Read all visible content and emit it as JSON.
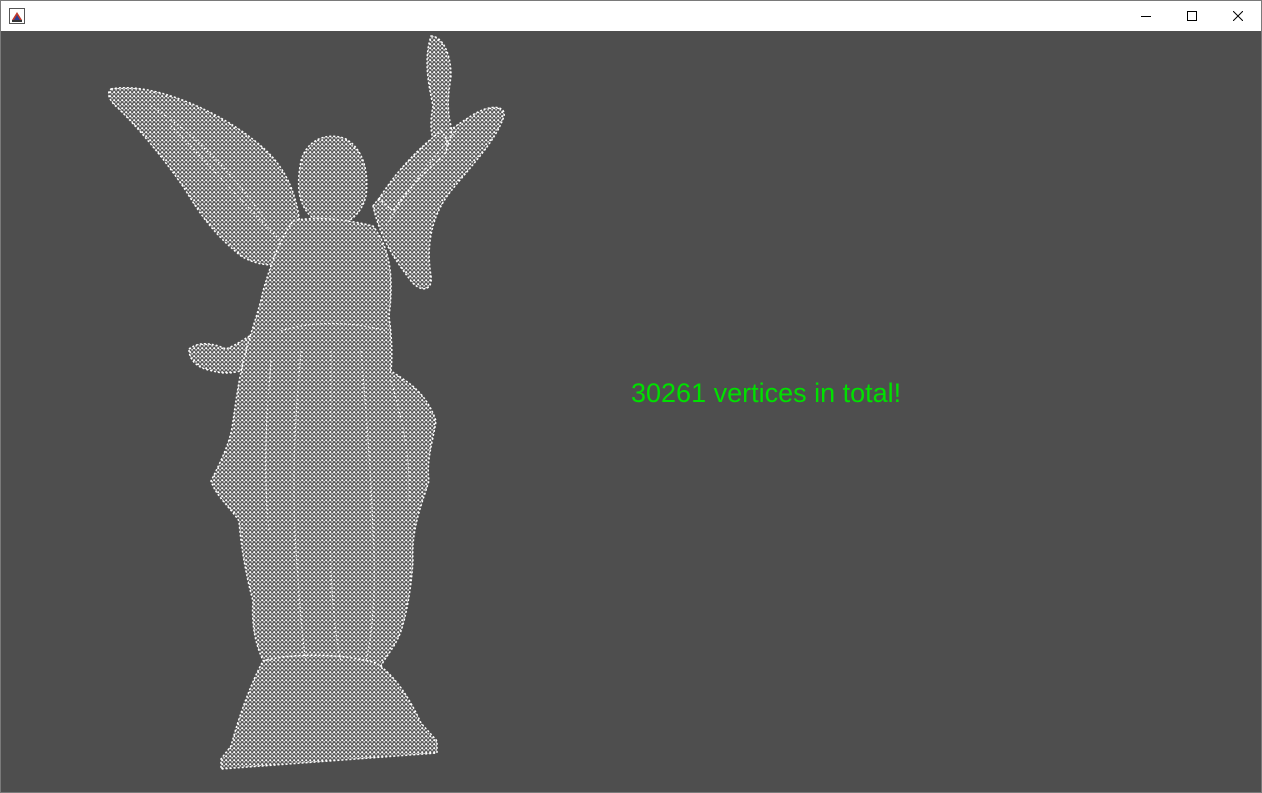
{
  "window": {
    "title": "",
    "app_icon": "java-app-icon",
    "buttons": {
      "minimize_icon": "minimize-icon",
      "maximize_icon": "maximize-icon",
      "close_icon": "close-icon"
    }
  },
  "scene": {
    "background_color": "#4e4e4e",
    "point_color": "#ffffff",
    "model": "angel-statue-point-cloud",
    "vertex_count_text": "30261 vertices in total!",
    "vertex_count": 30261,
    "text_color": "#00e000"
  }
}
